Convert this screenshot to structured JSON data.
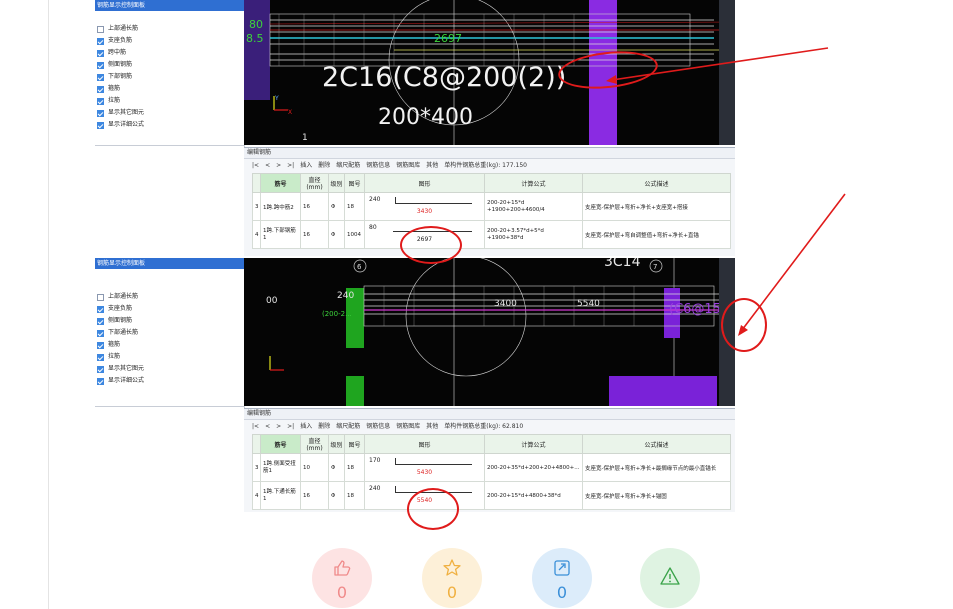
{
  "panel": {
    "title": "钢筋显示控制面板",
    "top_items": [
      {
        "label": "上部通长筋",
        "checked": false
      },
      {
        "label": "支座负筋",
        "checked": true
      },
      {
        "label": "跨中筋",
        "checked": true
      },
      {
        "label": "侧面钢筋",
        "checked": true
      },
      {
        "label": "下部钢筋",
        "checked": true
      },
      {
        "label": "箍筋",
        "checked": true
      },
      {
        "label": "拉筋",
        "checked": true
      },
      {
        "label": "显示其它图元",
        "checked": true
      },
      {
        "label": "显示详细公式",
        "checked": true
      }
    ],
    "bottom_items": [
      {
        "label": "上部通长筋",
        "checked": false
      },
      {
        "label": "支座负筋",
        "checked": true
      },
      {
        "label": "侧面钢筋",
        "checked": true
      },
      {
        "label": "下部通长筋",
        "checked": true
      },
      {
        "label": "箍筋",
        "checked": true
      },
      {
        "label": "拉筋",
        "checked": true
      },
      {
        "label": "显示其它图元",
        "checked": true
      },
      {
        "label": "显示详细公式",
        "checked": true
      }
    ]
  },
  "cad_top": {
    "label_big": "2C16(C8@200(2))",
    "label_size": "200*400",
    "dim_80": "80",
    "dim_8": "8.5",
    "dim_2697": "2697",
    "axis_num": "1"
  },
  "cad_bottom": {
    "dim_240": "240",
    "dim_200": "(200-2...",
    "dim_3400": "3400",
    "dim_5540": "5540",
    "dim_00": "00",
    "axis_6": "6",
    "axis_7": "7",
    "label_3c14": "3C14",
    "label_c6": "(C6@15"
  },
  "editor_top": {
    "title": "编辑钢筋",
    "toolbar": [
      "|<",
      "<",
      ">",
      ">|",
      "插入",
      "删除",
      "缩尺配筋",
      "钢筋信息",
      "钢筋图库",
      "其他",
      "单构件钢筋总重(kg): 177.150"
    ],
    "headers": [
      "筋号",
      "直径(mm)",
      "级别",
      "图号",
      "图形",
      "计算公式",
      "公式描述"
    ],
    "rows": [
      {
        "no": "3",
        "name": "1跨.跨中筋2",
        "dia": "16",
        "grade": "Φ",
        "fig": "18",
        "v1": "240",
        "v2": "3430",
        "formula": "200-20+15*d\n+1900+200+4600/4",
        "desc": "支座宽-保护层+弯折+净长+支座宽+搭接"
      },
      {
        "no": "4",
        "name": "1跨.下部钢筋1",
        "dia": "16",
        "grade": "Φ",
        "fig": "1004",
        "v1": "80",
        "v2": "2697",
        "formula": "200-20+3.57*d+5*d\n+1900+38*d",
        "desc": "支座宽-保护层+弯自调整值+弯折+净长+直锚"
      }
    ]
  },
  "editor_bottom": {
    "title": "编辑钢筋",
    "toolbar": [
      "|<",
      "<",
      ">",
      ">|",
      "插入",
      "删除",
      "缩尺配筋",
      "钢筋信息",
      "钢筋图库",
      "其他",
      "单构件钢筋总重(kg): 62.810"
    ],
    "headers": [
      "筋号",
      "直径(mm)",
      "级别",
      "图号",
      "图形",
      "计算公式",
      "公式描述"
    ],
    "rows": [
      {
        "no": "3",
        "name": "1跨.侧面受扭筋1",
        "dia": "10",
        "grade": "Φ",
        "fig": "18",
        "v1": "170",
        "v2": "5430",
        "formula": "200-20+35*d+200+20+4800+...",
        "desc": "支座宽-保护层+弯折+净长+最搁缘节点的最小直锚长"
      },
      {
        "no": "4",
        "name": "1跨.下通长筋1",
        "dia": "16",
        "grade": "Φ",
        "fig": "18",
        "v1": "240",
        "v2": "5540",
        "formula": "200-20+15*d+4800+38*d",
        "desc": "支座宽-保护层+弯折+净长+锚固"
      }
    ]
  },
  "reactions": [
    {
      "icon": "thumbs-up-icon",
      "count": "0",
      "color": "#f08a8a",
      "bg": "#fde3e3"
    },
    {
      "icon": "star-icon",
      "count": "0",
      "color": "#f0b040",
      "bg": "#fdf0d8"
    },
    {
      "icon": "share-icon",
      "count": "0",
      "color": "#3a8fd8",
      "bg": "#dcecfa"
    },
    {
      "icon": "warning-icon",
      "count": "",
      "color": "#3aa34a",
      "bg": "#dff3e2"
    }
  ]
}
